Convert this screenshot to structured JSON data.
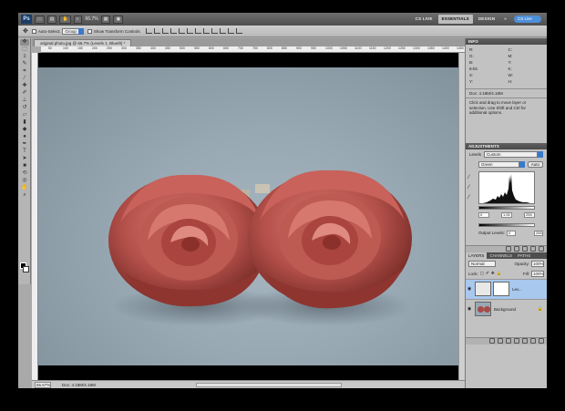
{
  "appbar": {
    "logo": "Ps",
    "zoom": "66.7%",
    "workspaces": [
      "CS LIVE",
      "ESSENTIALS",
      "DESIGN"
    ],
    "active_workspace": "ESSENTIALS",
    "overflow": "»",
    "search": "CS Live"
  },
  "options_bar": {
    "auto_select_label": "Auto-Select:",
    "auto_select_value": "Group",
    "show_transform_label": "Show Transform Controls"
  },
  "document": {
    "tab_title": "original photo.jpg @ 66.7% (Levels 1, Blue/8) *",
    "ruler_ticks": [
      "50",
      "100",
      "150",
      "200",
      "250",
      "300",
      "350",
      "400",
      "450",
      "500",
      "550",
      "600",
      "650",
      "700",
      "750",
      "800",
      "850",
      "900",
      "950",
      "1000",
      "1050",
      "1100",
      "1150",
      "1200",
      "1250",
      "1300",
      "1350",
      "1400",
      "1450"
    ]
  },
  "statusbar": {
    "zoom": "66.67%",
    "doc_info": "Doc: 4.18M/4.18M"
  },
  "info_panel": {
    "title": "INFO",
    "rows": [
      {
        "left": "R:",
        "right": "C:"
      },
      {
        "left": "G:",
        "right": "M:"
      },
      {
        "left": "B:",
        "right": "Y:"
      },
      {
        "left": "8-bit",
        "right": "K:"
      },
      {
        "left": "X:",
        "right": "W:"
      },
      {
        "left": "Y:",
        "right": "H:"
      }
    ],
    "doc": "Doc: 4.18M/4.18M",
    "hint": "Click and drag to move layer or selection. Use Shift and Ctrl for additional options."
  },
  "adjustments_panel": {
    "title": "ADJUSTMENTS",
    "levels_label": "Levels",
    "preset": "Custom",
    "channel": "Green",
    "auto_label": "Auto",
    "input_low": "0",
    "input_mid": "1.00",
    "input_high": "255",
    "output_label": "Output Levels:",
    "output_low": "0",
    "output_high": "255"
  },
  "layers_panel": {
    "tabs": [
      "LAYERS",
      "CHANNELS",
      "PATHS"
    ],
    "blend_mode": "Normal",
    "opacity_label": "Opacity:",
    "opacity": "100%",
    "lock_label": "Lock:",
    "fill_label": "Fill:",
    "fill": "100%",
    "layers": [
      {
        "name": "Lev...",
        "selected": true
      },
      {
        "name": "Background",
        "selected": false
      }
    ]
  }
}
